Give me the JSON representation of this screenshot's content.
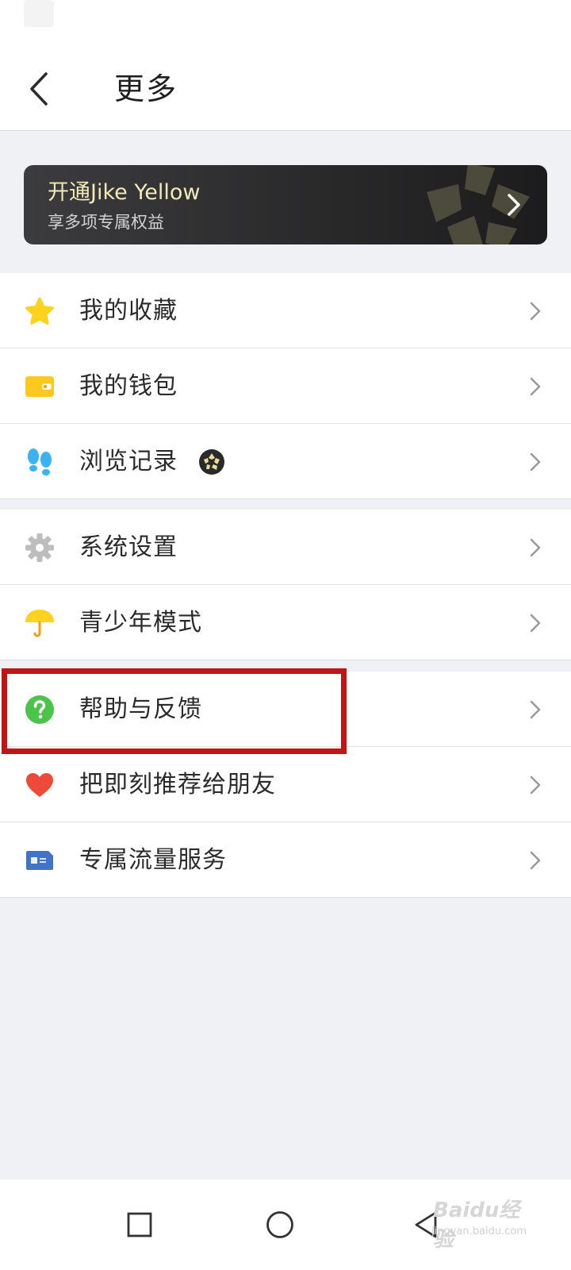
{
  "header": {
    "title": "更多",
    "back_icon": "chevron-left-icon"
  },
  "promo": {
    "title": "开通Jike Yellow",
    "subtitle": "享多项专属权益",
    "accent": "#f2e8b8",
    "chevron_icon": "chevron-right-icon"
  },
  "groups": [
    {
      "items": [
        {
          "label": "我的收藏",
          "icon": "star-icon",
          "color": "#ffd21e"
        },
        {
          "label": "我的钱包",
          "icon": "wallet-icon",
          "color": "#ffc81e"
        },
        {
          "label": "浏览记录",
          "icon": "footprints-icon",
          "color": "#3ab3f0",
          "badge": "jike-yellow-badge-icon"
        }
      ]
    },
    {
      "items": [
        {
          "label": "系统设置",
          "icon": "gear-icon",
          "color": "#bdbdbd"
        },
        {
          "label": "青少年模式",
          "icon": "umbrella-icon",
          "color": "#ffd21e"
        }
      ]
    },
    {
      "items": [
        {
          "label": "帮助与反馈",
          "icon": "help-icon",
          "color": "#4cc44a"
        },
        {
          "label": "把即刻推荐给朋友",
          "icon": "heart-icon",
          "color": "#ee4a3a"
        },
        {
          "label": "专属流量服务",
          "icon": "sim-card-icon",
          "color": "#3f74c9"
        }
      ]
    }
  ],
  "highlight": {
    "target": "帮助与反馈",
    "color": "#c11414"
  },
  "nav_bar": {
    "buttons": [
      "recent-apps-icon",
      "home-icon",
      "back-triangle-icon"
    ]
  },
  "watermark": {
    "text": "Baidu经验",
    "sub": "jingyan.baidu.com"
  }
}
